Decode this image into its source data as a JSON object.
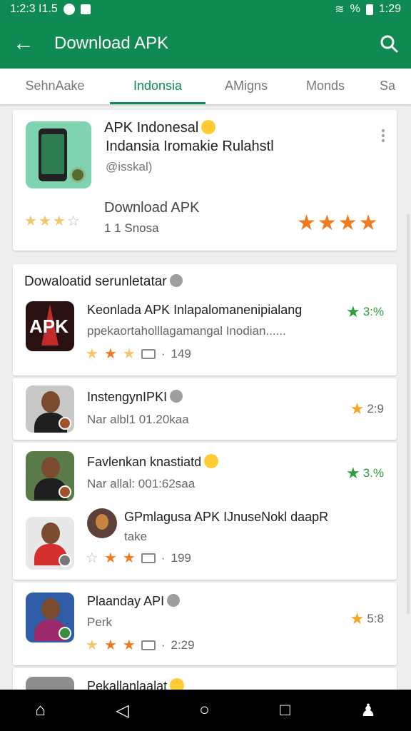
{
  "status": {
    "time_left": "1:2:3 I1.5",
    "time_right": "1:29",
    "battery": "%"
  },
  "appbar": {
    "title": "Download APK"
  },
  "tabs": [
    "SehnAake",
    "Indonsia",
    "AMigns",
    "Monds",
    "Sa"
  ],
  "featured": {
    "title": "APK Indonesal",
    "subtitle": "Indansia Iromakie Rulahstl",
    "developer": "@isskal)",
    "download_label": "Download APK",
    "size": "1 1 Snosa",
    "rating_small_stars": 2.5,
    "rating_big_stars": 4
  },
  "section": {
    "title": "Dowaloatid serunletatar",
    "items": [
      {
        "title": "Keonlada APK Inlapalomanenipialang",
        "subtitle": "ppekaortaholllagamangal Inodian......",
        "meta_count": "149",
        "rating": "3:%"
      }
    ]
  },
  "rows": [
    {
      "title": "InstengynIPKI",
      "subtitle": "Nar albl1 01.20kaa",
      "rating": "2:9"
    },
    {
      "title": "Favlenkan knastiatd",
      "subtitle": "Nar allal: 001:62saa",
      "rating": "3.%"
    },
    {
      "title": "GPmlagusa APK IJnuseNokl daapR",
      "subtitle": "take",
      "meta_count": "199"
    },
    {
      "title": "Plaanday API",
      "subtitle": "Perk",
      "meta_count": "2:29",
      "rating": "5:8"
    },
    {
      "title": "Pekallanlaalat"
    }
  ],
  "nav": {
    "home": "⌂",
    "back": "◁",
    "circle": "○",
    "square": "□",
    "person": "♟"
  }
}
